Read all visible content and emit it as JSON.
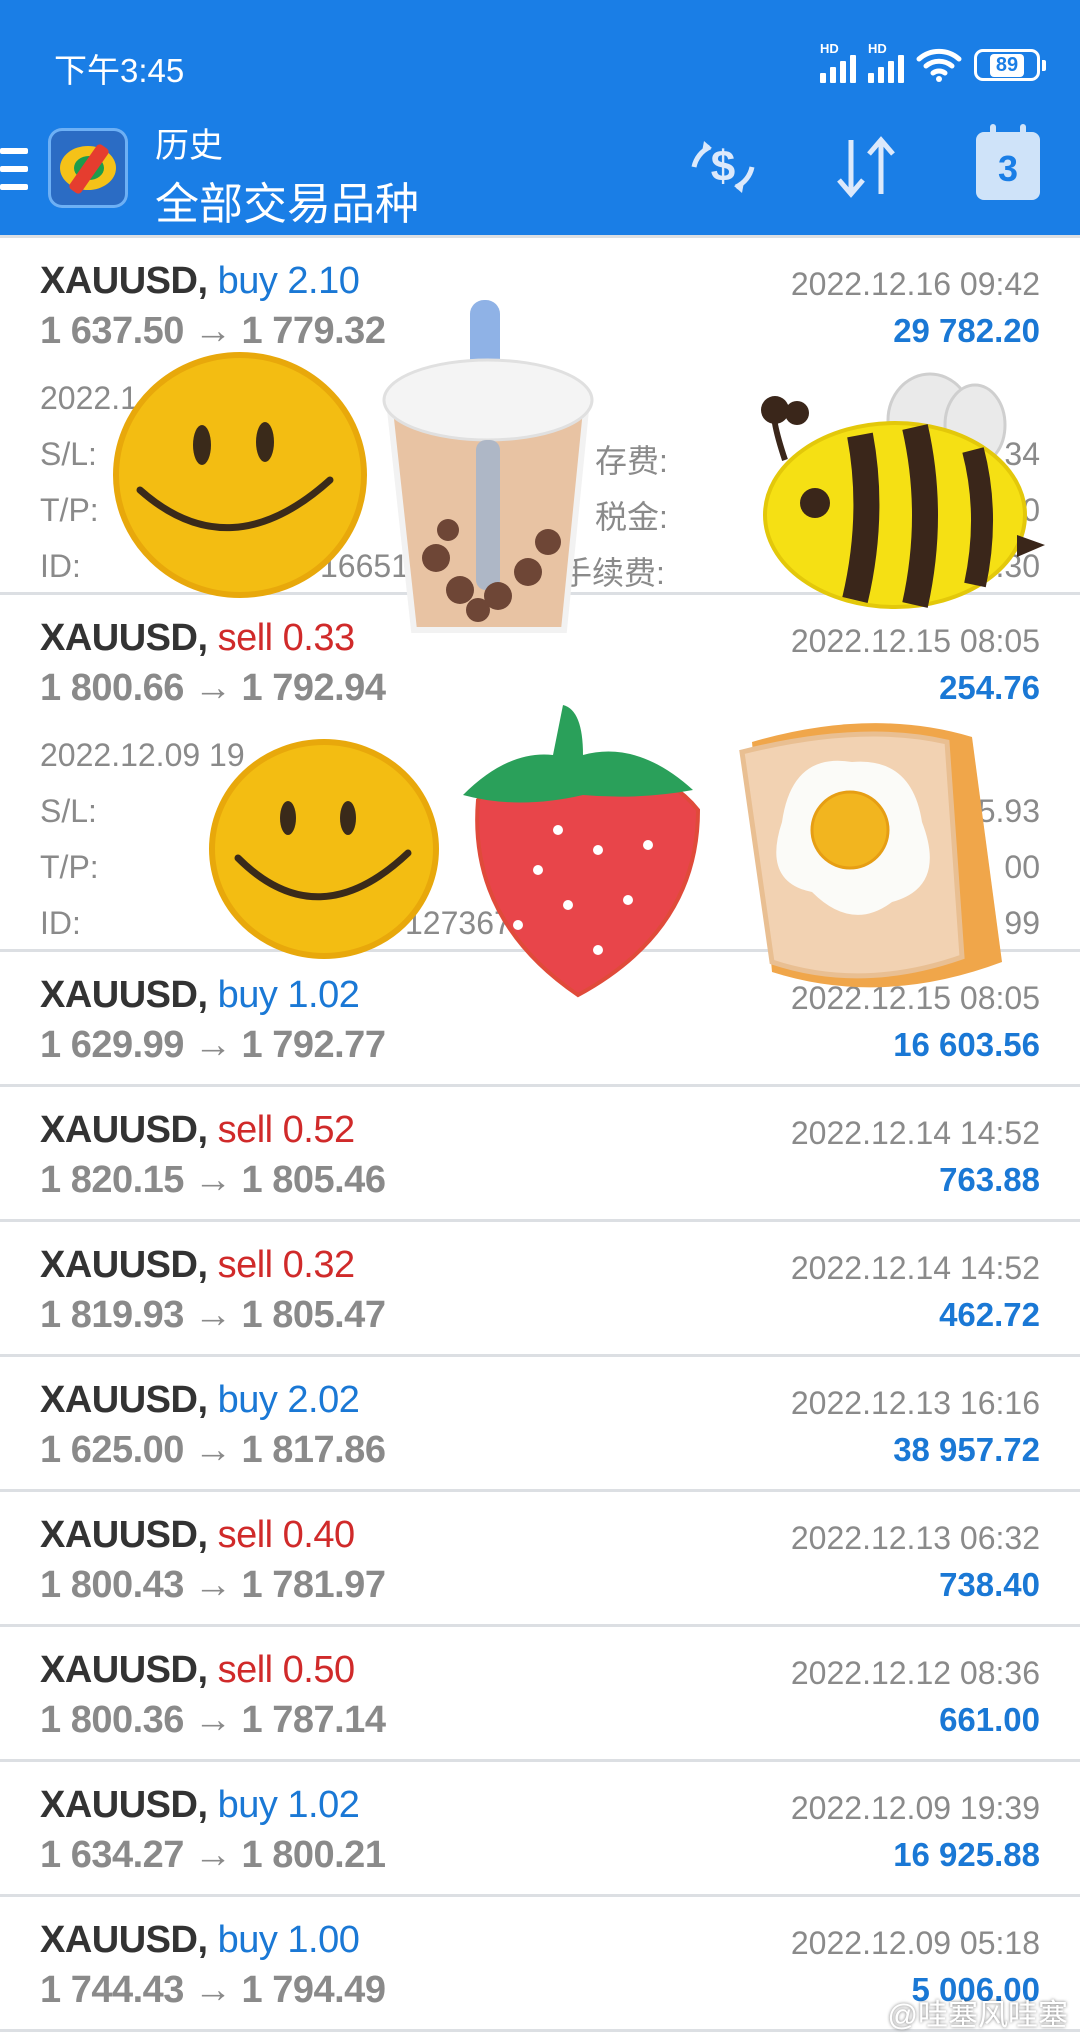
{
  "status_bar": {
    "time": "下午3:45",
    "hd1": "HD",
    "hd2": "HD",
    "battery": "89"
  },
  "header": {
    "subtitle": "历史",
    "title": "全部交易品种",
    "calendar_day": "3"
  },
  "trades": [
    {
      "symbol": "XAUUSD,",
      "direction": "buy",
      "lots": "2.10",
      "dir_text": "buy 2.10",
      "prices": "1 637.50 → 1 779.32",
      "datetime": "2022.12.16 09:42",
      "profit": "29 782.20",
      "expanded": true,
      "open_time": "2022.1",
      "sl_label": "S/L:",
      "tp_label": "T/P:",
      "id_label": "ID:",
      "id_value": "16651",
      "swap_label": "存费:",
      "tax_label": "税金:",
      "commission_label": "手续费:",
      "swap_value": ".34",
      "tax_value": "00",
      "commission_value": ".30"
    },
    {
      "symbol": "XAUUSD,",
      "direction": "sell",
      "lots": "0.33",
      "dir_text": "sell 0.33",
      "prices": "1 800.66 → 1 792.94",
      "datetime": "2022.12.15 08:05",
      "profit": "254.76",
      "expanded": true,
      "open_time": "2022.12.09 19",
      "sl_label": "S/L:",
      "tp_label": "T/P:",
      "id_label": "ID:",
      "id_value": "127367",
      "swap_value": "5.93",
      "tax_value": "00",
      "commission_value": "99"
    },
    {
      "symbol": "XAUUSD,",
      "direction": "buy",
      "dir_text": "buy 1.02",
      "prices": "1 629.99 → 1 792.77",
      "datetime": "2022.12.15 08:05",
      "profit": "16 603.56"
    },
    {
      "symbol": "XAUUSD,",
      "direction": "sell",
      "dir_text": "sell 0.52",
      "prices": "1 820.15 → 1 805.46",
      "datetime": "2022.12.14 14:52",
      "profit": "763.88"
    },
    {
      "symbol": "XAUUSD,",
      "direction": "sell",
      "dir_text": "sell 0.32",
      "prices": "1 819.93 → 1 805.47",
      "datetime": "2022.12.14 14:52",
      "profit": "462.72"
    },
    {
      "symbol": "XAUUSD,",
      "direction": "buy",
      "dir_text": "buy 2.02",
      "prices": "1 625.00 → 1 817.86",
      "datetime": "2022.12.13 16:16",
      "profit": "38 957.72"
    },
    {
      "symbol": "XAUUSD,",
      "direction": "sell",
      "dir_text": "sell 0.40",
      "prices": "1 800.43 → 1 781.97",
      "datetime": "2022.12.13 06:32",
      "profit": "738.40"
    },
    {
      "symbol": "XAUUSD,",
      "direction": "sell",
      "dir_text": "sell 0.50",
      "prices": "1 800.36 → 1 787.14",
      "datetime": "2022.12.12 08:36",
      "profit": "661.00"
    },
    {
      "symbol": "XAUUSD,",
      "direction": "buy",
      "dir_text": "buy 1.02",
      "prices": "1 634.27 → 1 800.21",
      "datetime": "2022.12.09 19:39",
      "profit": "16 925.88"
    },
    {
      "symbol": "XAUUSD,",
      "direction": "buy",
      "dir_text": "buy 1.00",
      "prices": "1 744.43 → 1 794.49",
      "datetime": "2022.12.09 05:18",
      "profit": "5 006.00"
    }
  ],
  "watermark": "@哇塞风哇塞",
  "colors": {
    "header_bg": "#1a7ee6",
    "buy": "#1a78d5",
    "sell": "#d02a2a",
    "profit": "#1a78d5",
    "muted": "#8a8a8a"
  }
}
